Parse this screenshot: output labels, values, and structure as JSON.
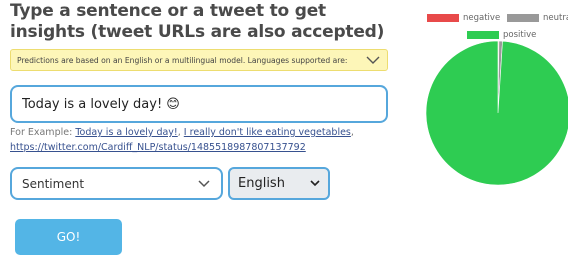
{
  "header": {
    "title": "Type a sentence or a tweet to get insights (tweet URLs are also accepted)"
  },
  "notice": {
    "text": "Predictions are based on an English or a multilingual model. Languages supported are:",
    "icon": "chevron-down-icon"
  },
  "input": {
    "value": "Today is a lovely day! 😊"
  },
  "examples": {
    "prefix": "For Example: ",
    "links": [
      "Today is a lovely day!",
      "I really don't like eating vegetables",
      "https://twitter.com/Cardiff_NLP/status/1485518987807137792"
    ],
    "separator": ", "
  },
  "task_select": {
    "selected": "Sentiment",
    "icon": "chevron-down-icon"
  },
  "language_select": {
    "selected": "English",
    "icon": "chevron-down-icon"
  },
  "go_button": {
    "label": "GO!"
  },
  "colors": {
    "negative": "#e84a4a",
    "neutral": "#999999",
    "positive": "#2ecc52",
    "accent": "#56a7dc",
    "button": "#53b5e6"
  },
  "chart_data": {
    "type": "pie",
    "title": "",
    "labels": [
      "negative",
      "neutral",
      "positive"
    ],
    "values": [
      0.002,
      0.008,
      0.99
    ],
    "legend": "top"
  }
}
